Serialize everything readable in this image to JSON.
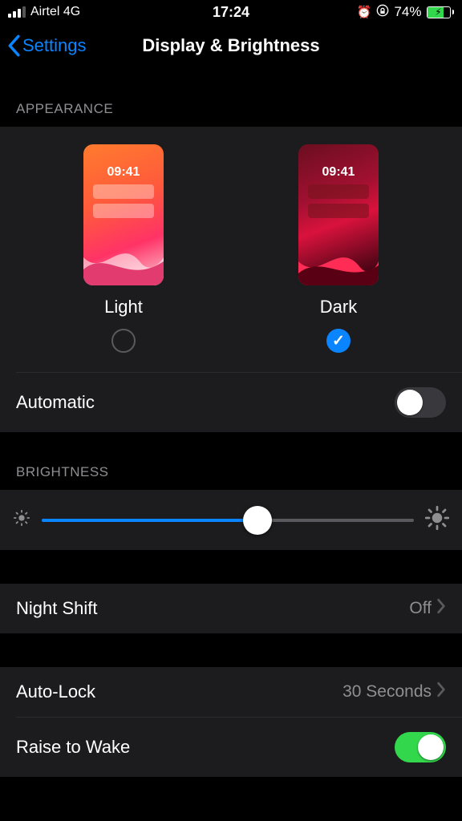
{
  "status": {
    "carrier": "Airtel 4G",
    "time": "17:24",
    "battery_pct": "74%"
  },
  "nav": {
    "back": "Settings",
    "title": "Display & Brightness"
  },
  "appearance": {
    "header": "APPEARANCE",
    "options": {
      "light": "Light",
      "dark": "Dark"
    },
    "selected": "dark",
    "preview_time": "09:41",
    "automatic_label": "Automatic",
    "automatic_value": false
  },
  "brightness": {
    "header": "BRIGHTNESS",
    "value_pct": 58
  },
  "night_shift": {
    "label": "Night Shift",
    "value": "Off"
  },
  "auto_lock": {
    "label": "Auto-Lock",
    "value": "30 Seconds"
  },
  "raise_to_wake": {
    "label": "Raise to Wake",
    "value": true
  }
}
